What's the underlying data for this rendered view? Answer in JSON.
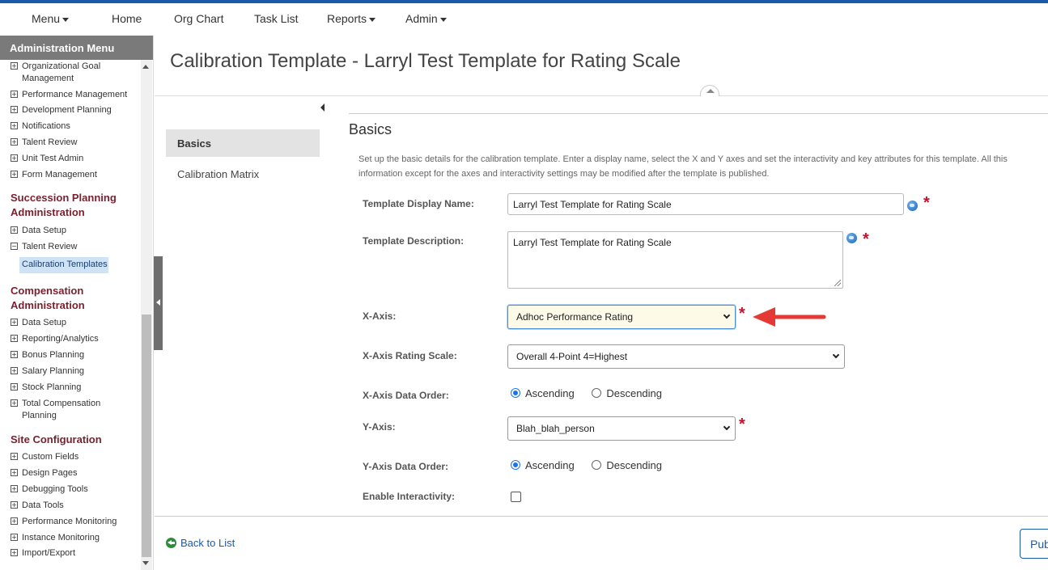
{
  "topnav": {
    "menu": "Menu",
    "home": "Home",
    "org_chart": "Org Chart",
    "task_list": "Task List",
    "reports": "Reports",
    "admin": "Admin"
  },
  "sidebar": {
    "header": "Administration Menu",
    "items_top": [
      "Organizational Goal",
      "Management",
      "Performance Management",
      "Development Planning",
      "Notifications",
      "Talent Review",
      "Unit Test Admin",
      "Form Management"
    ],
    "succession_title_1": "Succession Planning",
    "succession_title_2": "Administration",
    "succession_items": [
      "Data Setup",
      "Talent Review"
    ],
    "active_item": "Calibration Templates",
    "comp_title_1": "Compensation",
    "comp_title_2": "Administration",
    "comp_items": [
      "Data Setup",
      "Reporting/Analytics",
      "Bonus Planning",
      "Salary Planning",
      "Stock Planning",
      "Total Compensation",
      "Planning"
    ],
    "site_title": "Site Configuration",
    "site_items": [
      "Custom Fields",
      "Design Pages",
      "Debugging Tools",
      "Data Tools",
      "Performance Monitoring",
      "Instance Monitoring",
      "Import/Export"
    ]
  },
  "page": {
    "title": "Calibration Template - Larryl Test Template for Rating Scale"
  },
  "left_tabs": {
    "basics": "Basics",
    "matrix": "Calibration Matrix"
  },
  "form": {
    "section_title": "Basics",
    "description_line1": "Set up the basic details for the calibration template. Enter a display name, select the X and Y axes and set the interactivity and key attributes for this template. All this",
    "description_line2": "information except for the axes and interactivity settings may be modified after the template is published.",
    "display_name_label": "Template Display Name:",
    "display_name_value": "Larryl Test Template for Rating Scale",
    "description_label": "Template Description:",
    "description_value": "Larryl Test Template for Rating Scale",
    "x_axis_label": "X-Axis:",
    "x_axis_value": "Adhoc Performance Rating",
    "x_scale_label": "X-Axis Rating Scale:",
    "x_scale_value": "Overall 4-Point 4=Highest",
    "x_order_label": "X-Axis Data Order:",
    "y_axis_label": "Y-Axis:",
    "y_axis_value": "Blah_blah_person",
    "y_order_label": "Y-Axis Data Order:",
    "ascending": "Ascending",
    "descending": "Descending",
    "x_order_selected": "Ascending",
    "y_order_selected": "Ascending",
    "interactivity_label": "Enable Interactivity:",
    "interactivity_checked": false,
    "required_mark": "*"
  },
  "footer": {
    "back": "Back to List",
    "publish": "Pub"
  },
  "colors": {
    "accent": "#1a5aa8",
    "section_title": "#7a1f2e",
    "required": "#c8102e",
    "annotation_arrow": "#e53935"
  }
}
